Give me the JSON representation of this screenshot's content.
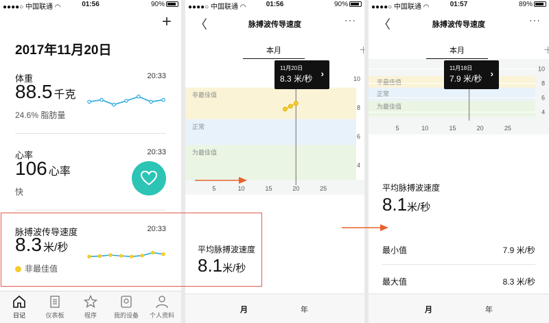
{
  "screens": [
    {
      "status": {
        "carrier": "中国联通",
        "time": "01:56",
        "battery": "90%"
      },
      "date_title": "2017年11月20日",
      "weight": {
        "label": "体重",
        "time": "20:33",
        "value": "88.5",
        "unit": "千克",
        "sub": "24.6% 脂肪量",
        "spark": [
          0.45,
          0.55,
          0.3,
          0.5,
          0.72,
          0.45,
          0.55
        ]
      },
      "heart": {
        "label": "心率",
        "time": "20:33",
        "value": "106",
        "unit": "心率",
        "sub": "快"
      },
      "pwv": {
        "label": "脉搏波传导速度",
        "time": "20:33",
        "value": "8.3",
        "unit": "米/秒",
        "status": "非最佳值",
        "spark": [
          0.35,
          0.4,
          0.5,
          0.42,
          0.35,
          0.45,
          0.75,
          0.6
        ]
      },
      "tabs": [
        {
          "label": "日记",
          "icon": "home-icon"
        },
        {
          "label": "仪表板",
          "icon": "dashboard-icon"
        },
        {
          "label": "程序",
          "icon": "star-icon"
        },
        {
          "label": "我的设备",
          "icon": "device-icon"
        },
        {
          "label": "个人资料",
          "icon": "user-icon"
        }
      ]
    },
    {
      "status": {
        "carrier": "中国联通",
        "time": "01:56",
        "battery": "90%"
      },
      "title": "脉搏波传导速度",
      "segment_active": "本月",
      "segment_next": "十",
      "tooltip": {
        "date": "11月20日",
        "value": "8.3 米/秒"
      },
      "zones": [
        "非最佳值",
        "正常",
        "为最佳值"
      ],
      "avg_label": "平均脉搏波速度",
      "avg_value": "8.1",
      "avg_unit": "米/秒",
      "bottom_tabs": [
        "月",
        "年"
      ]
    },
    {
      "status": {
        "carrier": "中国联通",
        "time": "01:57",
        "battery": "89%"
      },
      "title": "脉搏波传导速度",
      "segment_active": "本月",
      "segment_next": "十",
      "tooltip": {
        "date": "11月18日",
        "value": "7.9 米/秒"
      },
      "zones": [
        "非最佳值",
        "正常",
        "为最佳值"
      ],
      "avg_label": "平均脉搏波速度",
      "avg_value": "8.1",
      "avg_unit": "米/秒",
      "min_label": "最小值",
      "min_value": "7.9 米/秒",
      "max_label": "最大值",
      "max_value": "8.3 米/秒",
      "bottom_tabs": [
        "月",
        "年"
      ]
    }
  ],
  "chart_data": [
    {
      "type": "line",
      "x_ticks": [
        "5",
        "10",
        "15",
        "20",
        "25"
      ],
      "y_ticks": [
        "10",
        "8",
        "6",
        "4"
      ],
      "xlim": [
        1,
        30
      ],
      "ylim": [
        3,
        11
      ],
      "x": [
        18,
        19,
        20
      ],
      "values": [
        7.9,
        8.1,
        8.3
      ],
      "selected_x": 20
    },
    {
      "type": "line",
      "x_ticks": [
        "5",
        "10",
        "15",
        "20",
        "25"
      ],
      "y_ticks": [
        "10",
        "8",
        "6",
        "4"
      ],
      "xlim": [
        1,
        30
      ],
      "ylim": [
        3,
        11
      ],
      "x": [
        18
      ],
      "values": [
        7.9
      ],
      "selected_x": 18
    }
  ],
  "colors": {
    "accent": "#29a8df",
    "heart": "#2cc4b5",
    "point": "#f5cc2a",
    "highlight": "#e05a4c",
    "arrow": "#e8602c",
    "zone_bad": "#fbf3d6",
    "zone_normal": "#e8f2fa",
    "zone_good": "#eaf5e4"
  }
}
